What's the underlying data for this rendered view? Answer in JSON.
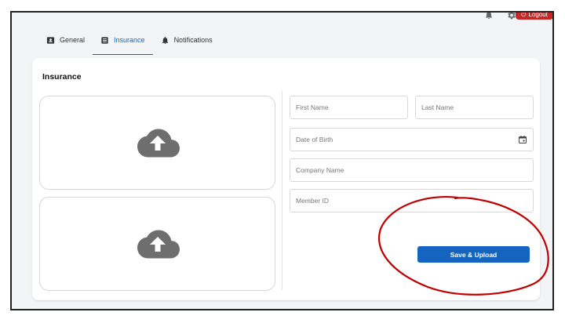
{
  "header": {
    "logout_label": "Logout",
    "logout_icon": "power-icon",
    "bell_icon": "bell-icon",
    "gear_icon": "gear-icon"
  },
  "tabs": [
    {
      "label": "General",
      "icon": "id-card-icon",
      "active": false
    },
    {
      "label": "Insurance",
      "icon": "document-list-icon",
      "active": true
    },
    {
      "label": "Notifications",
      "icon": "bell-icon",
      "active": false
    }
  ],
  "card": {
    "title": "Insurance",
    "upload_icon": "cloud-upload-icon"
  },
  "form": {
    "first_name_placeholder": "First Name",
    "last_name_placeholder": "Last Name",
    "dob_placeholder": "Date of Birth",
    "company_placeholder": "Company Name",
    "member_id_placeholder": "Member ID",
    "calendar_icon": "calendar-icon",
    "save_label": "Save & Upload"
  },
  "colors": {
    "accent": "#1565c0",
    "logout": "#c62828",
    "annotation": "#c00000"
  }
}
